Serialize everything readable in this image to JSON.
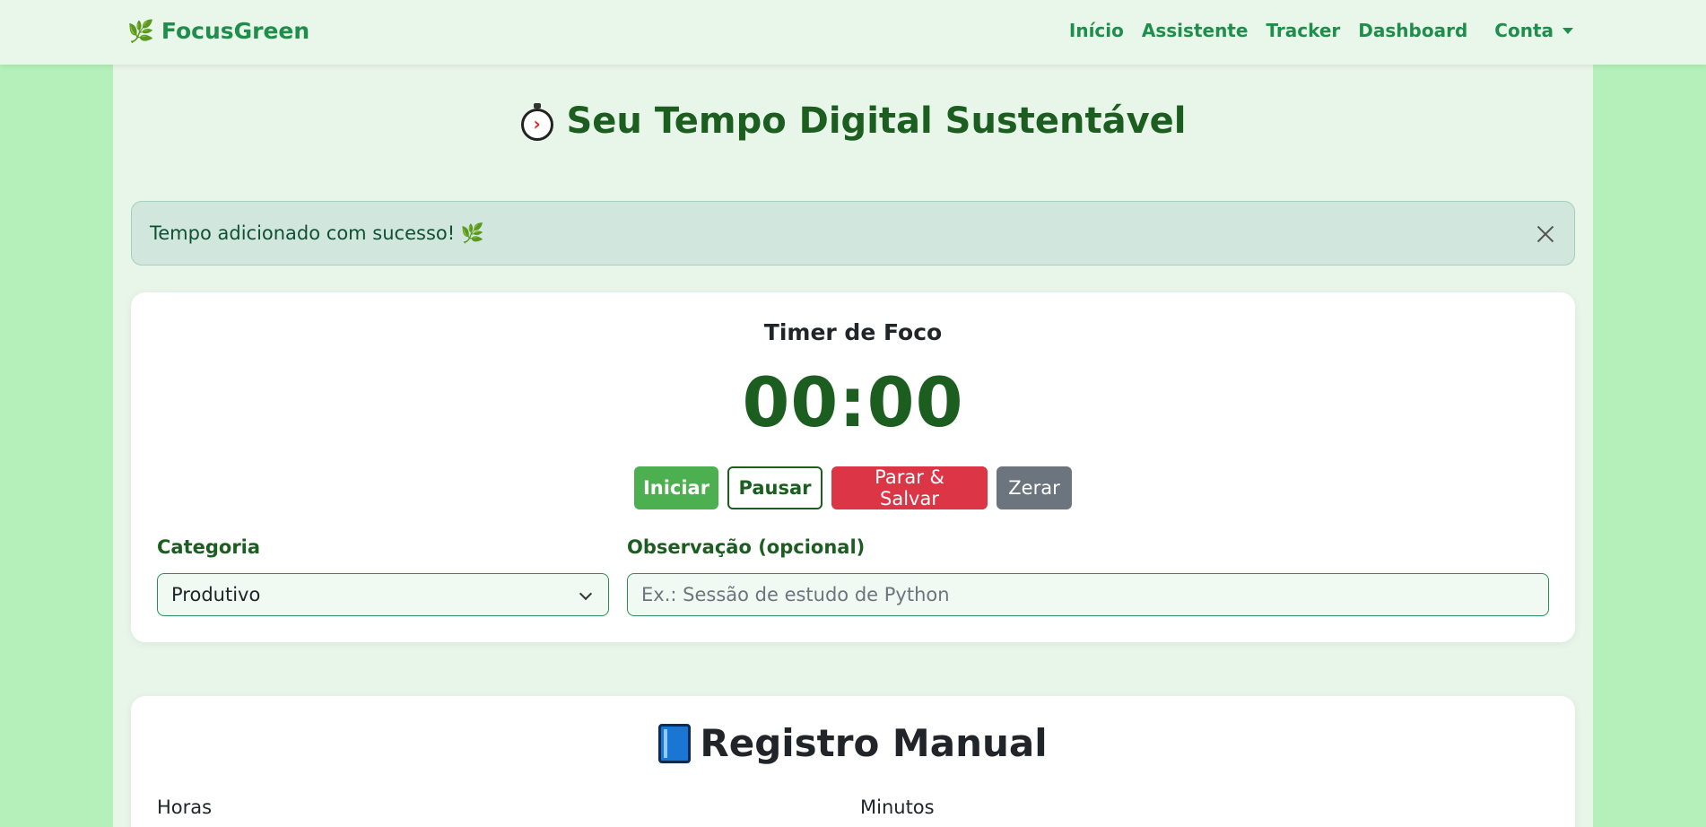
{
  "navbar": {
    "brand": "FocusGreen",
    "links": [
      "Início",
      "Assistente",
      "Tracker",
      "Dashboard"
    ],
    "account": "Conta"
  },
  "page": {
    "title": "Seu Tempo Digital Sustentável"
  },
  "alert": {
    "message": "Tempo adicionado com sucesso! 🌿"
  },
  "timer": {
    "title": "Timer de Foco",
    "display": "00:00",
    "buttons": {
      "start": "Iniciar",
      "pause": "Pausar",
      "stop_save": "Parar & Salvar",
      "reset": "Zerar"
    },
    "category_label": "Categoria",
    "category_value": "Produtivo",
    "note_label": "Observação (opcional)",
    "note_placeholder": "Ex.: Sessão de estudo de Python"
  },
  "manual": {
    "title": "Registro Manual",
    "hours_label": "Horas",
    "minutes_label": "Minutos"
  },
  "colors": {
    "brand_green": "#1e8e4a",
    "dark_green": "#1b5e20",
    "start_green": "#4caf50",
    "danger_red": "#dc3545",
    "neutral_gray": "#6c757d",
    "page_bg": "#b5f0bb"
  }
}
